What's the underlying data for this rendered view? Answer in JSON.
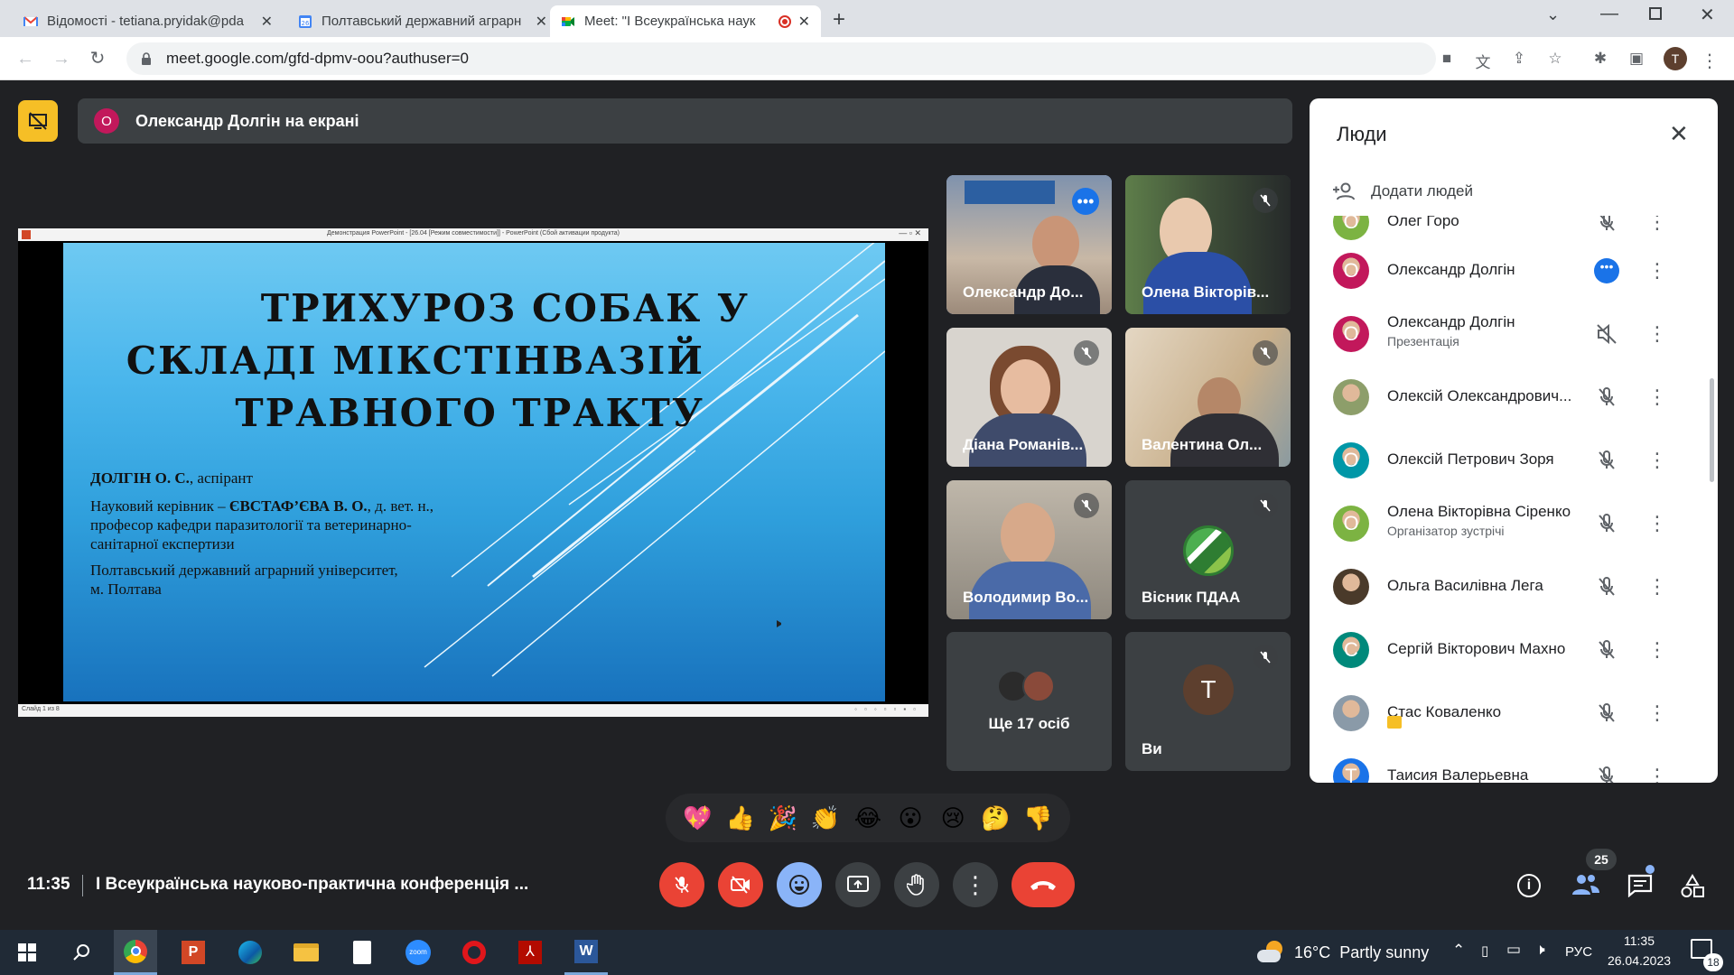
{
  "browser": {
    "tabs": [
      {
        "title": "Відомості - tetiana.pryidak@pda",
        "active": false
      },
      {
        "title": "Полтавський державний аграрн",
        "active": false
      },
      {
        "title": "Meet: \"І Всеукраїнська наук",
        "active": true
      }
    ],
    "url": "meet.google.com/gfd-dpmv-oou?authuser=0",
    "profile_initial": "T"
  },
  "banner": {
    "avatar_initial": "О",
    "text": "Олександр Долгін на екрані"
  },
  "slide": {
    "window_caption": "Демонстрация PowerPoint - [26.04 [Режим совместимости]] - PowerPoint (Сбой активации продукта)",
    "title_lines": [
      "ТРИХУРОЗ СОБАК У",
      "СКЛАДІ МІКСТІНВАЗІЙ",
      "ТРАВНОГО ТРАКТУ"
    ],
    "author_bold": "ДОЛГІН О. С.",
    "author_rest": ", аспірант",
    "advisor_prefix": "Науковий керівник – ",
    "advisor_bold": "ЄВСТАФ’ЄВА В. О.",
    "advisor_rest": ", д. вет. н.,",
    "advisor_line2": "професор кафедри паразитології та ветеринарно-",
    "advisor_line3": "санітарної експертизи",
    "university_line1": "Полтавський державний аграрний університет,",
    "university_line2": "м. Полтава",
    "status_left": "Слайд 1 из 8"
  },
  "tiles": [
    {
      "name": "Олександр До..."
    },
    {
      "name": "Олена Вікторів..."
    },
    {
      "name": "Діана Романів..."
    },
    {
      "name": "Валентина Ол..."
    },
    {
      "name": "Володимир Во..."
    },
    {
      "name": "Вісник ПДАА"
    },
    {
      "name": "Ще 17 осіб"
    },
    {
      "name": "Ви",
      "avatar_initial": "T"
    }
  ],
  "people_panel": {
    "title": "Люди",
    "add_label": "Додати людей",
    "people": [
      {
        "name": "Олег Горо",
        "initial": "О",
        "color": "#7cb342",
        "sub": ""
      },
      {
        "name": "Олександр Долгін",
        "initial": "О",
        "color": "#c2185b",
        "sub": ""
      },
      {
        "name": "Олександр Долгін",
        "initial": "О",
        "color": "#c2185b",
        "sub": "Презентація"
      },
      {
        "name": "Олексій Олександрович...",
        "initial": "",
        "color": "#8d9e6a",
        "sub": ""
      },
      {
        "name": "Олексій Петрович Зоря",
        "initial": "О",
        "color": "#0097a7",
        "sub": ""
      },
      {
        "name": "Олена Вікторівна Сіренко",
        "initial": "О",
        "color": "#7cb342",
        "sub": "Організатор зустрічі"
      },
      {
        "name": "Ольга Василівна Лега",
        "initial": "",
        "color": "#4a3a2a",
        "sub": ""
      },
      {
        "name": "Сергій Вікторович Махно",
        "initial": "С",
        "color": "#00897b",
        "sub": ""
      },
      {
        "name": "Стас Коваленко",
        "initial": "",
        "color": "#8a9aa8",
        "sub": ""
      },
      {
        "name": "Таисия Валерьевна",
        "initial": "Т",
        "color": "#1a73e8",
        "sub": ""
      }
    ]
  },
  "reactions": [
    "💖",
    "👍",
    "🎉",
    "👏",
    "😂",
    "😮",
    "😢",
    "🤔",
    "👎"
  ],
  "meeting": {
    "time": "11:35",
    "title": "І Всеукраїнська науково-практична конференція ...",
    "participants_count": "25"
  },
  "taskbar": {
    "weather": "16°C  Partly sunny",
    "lang": "РУС",
    "clock_time": "11:35",
    "clock_date": "26.04.2023",
    "notif_count": "18",
    "zoom_label": "zoom"
  }
}
